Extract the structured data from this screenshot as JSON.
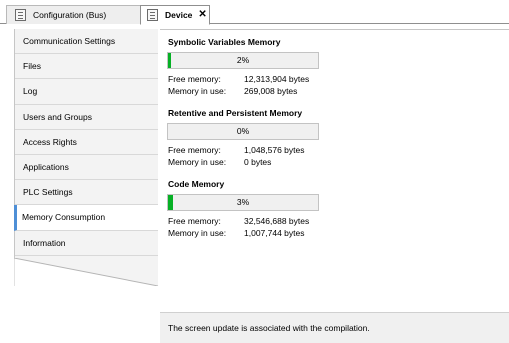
{
  "tabs": [
    {
      "label": "Configuration (Bus)",
      "active": false
    },
    {
      "label": "Device",
      "active": true
    }
  ],
  "nav": {
    "selected": "Memory Consumption",
    "items": [
      "Communication Settings",
      "Files",
      "Log",
      "Users and Groups",
      "Access Rights",
      "Applications",
      "PLC Settings",
      "Memory Consumption",
      "Information"
    ]
  },
  "sections": [
    {
      "title": "Symbolic Variables Memory",
      "percent_label": "2%",
      "percent": 2,
      "free_label": "Free memory:",
      "free_value": "12,313,904 bytes",
      "used_label": "Memory in use:",
      "used_value": "269,008 bytes"
    },
    {
      "title": "Retentive and Persistent Memory",
      "percent_label": "0%",
      "percent": 0,
      "free_label": "Free memory:",
      "free_value": "1,048,576 bytes",
      "used_label": "Memory in use:",
      "used_value": "0 bytes"
    },
    {
      "title": "Code Memory",
      "percent_label": "3%",
      "percent": 3,
      "free_label": "Free memory:",
      "free_value": "32,546,688 bytes",
      "used_label": "Memory in use:",
      "used_value": "1,007,744 bytes"
    }
  ],
  "status_text": "The screen update is associated with the compilation.",
  "colors": {
    "progress": "#06b025",
    "selected_accent": "#4e8fd6"
  }
}
